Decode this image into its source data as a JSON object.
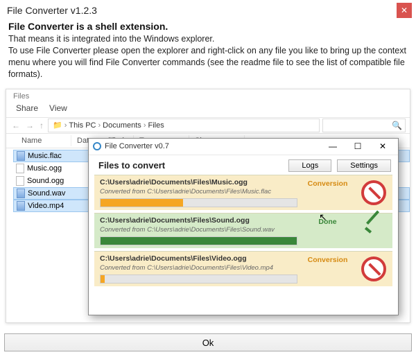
{
  "window": {
    "title": "File Converter v1.2.3",
    "close": "✕"
  },
  "intro": {
    "heading": "File Converter is a shell extension.",
    "body": "That means it is integrated into the Windows explorer.\nTo use File Converter please open the explorer and right-click on any file you like to bring up the context menu where you will find File Converter commands (see the readme file to see the list of compatible file formats)."
  },
  "explorer": {
    "tab": "Files",
    "ribbon": [
      "Share",
      "View"
    ],
    "breadcrumb": [
      "This PC",
      "Documents",
      "Files"
    ],
    "columns": [
      "Name",
      "Date modified",
      "Type",
      "Size"
    ],
    "files": [
      {
        "name": "Music.flac",
        "selected": true,
        "icon": "blue"
      },
      {
        "name": "Music.ogg",
        "selected": false,
        "icon": "plain"
      },
      {
        "name": "Sound.ogg",
        "selected": false,
        "icon": "plain"
      },
      {
        "name": "Sound.wav",
        "selected": true,
        "icon": "blue"
      },
      {
        "name": "Video.mp4",
        "selected": true,
        "icon": "blue"
      }
    ]
  },
  "converter": {
    "title": "File Converter v0.7",
    "heading": "Files to convert",
    "buttons": {
      "logs": "Logs",
      "settings": "Settings"
    },
    "items": [
      {
        "path": "C:\\Users\\adrie\\Documents\\Files\\Music.ogg",
        "src": "Converted from C:\\Users\\adrie\\Documents\\Files\\Music.flac",
        "status": "Conversion",
        "progress": 42,
        "theme": "yellow",
        "icon": "stop"
      },
      {
        "path": "C:\\Users\\adrie\\Documents\\Files\\Sound.ogg",
        "src": "Converted from C:\\Users\\adrie\\Documents\\Files\\Sound.wav",
        "status": "Done",
        "progress": 100,
        "theme": "green",
        "icon": "check"
      },
      {
        "path": "C:\\Users\\adrie\\Documents\\Files\\Video.ogg",
        "src": "Converted from C:\\Users\\adrie\\Documents\\Files\\Video.mp4",
        "status": "Conversion",
        "progress": 2,
        "theme": "yellow",
        "icon": "stop"
      }
    ]
  },
  "ok": "Ok"
}
